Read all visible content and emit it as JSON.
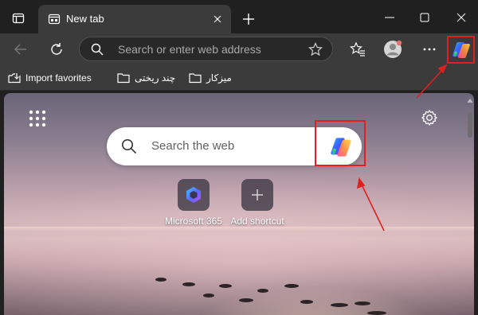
{
  "tabs": [
    {
      "title": "New tab"
    }
  ],
  "address_bar": {
    "placeholder": "Search or enter web address"
  },
  "favorites": [
    {
      "label": "Import favorites"
    },
    {
      "label": "چند ریختی"
    },
    {
      "label": "میزکار"
    }
  ],
  "search": {
    "placeholder": "Search the web"
  },
  "quick_links": [
    {
      "label": "Microsoft 365"
    },
    {
      "label": "Add shortcut"
    }
  ],
  "colors": {
    "annotation": "#e02020",
    "chrome": "#202020",
    "toolbar": "#3b3b3b"
  },
  "icons": {
    "tab_actions": "tab-actions-icon",
    "back": "back-arrow-icon",
    "refresh": "refresh-icon",
    "favorites": "favorites-icon",
    "profile": "profile-avatar-icon",
    "more": "more-icon",
    "copilot": "copilot-icon",
    "apps": "apps-grid-icon",
    "settings": "gear-icon"
  }
}
